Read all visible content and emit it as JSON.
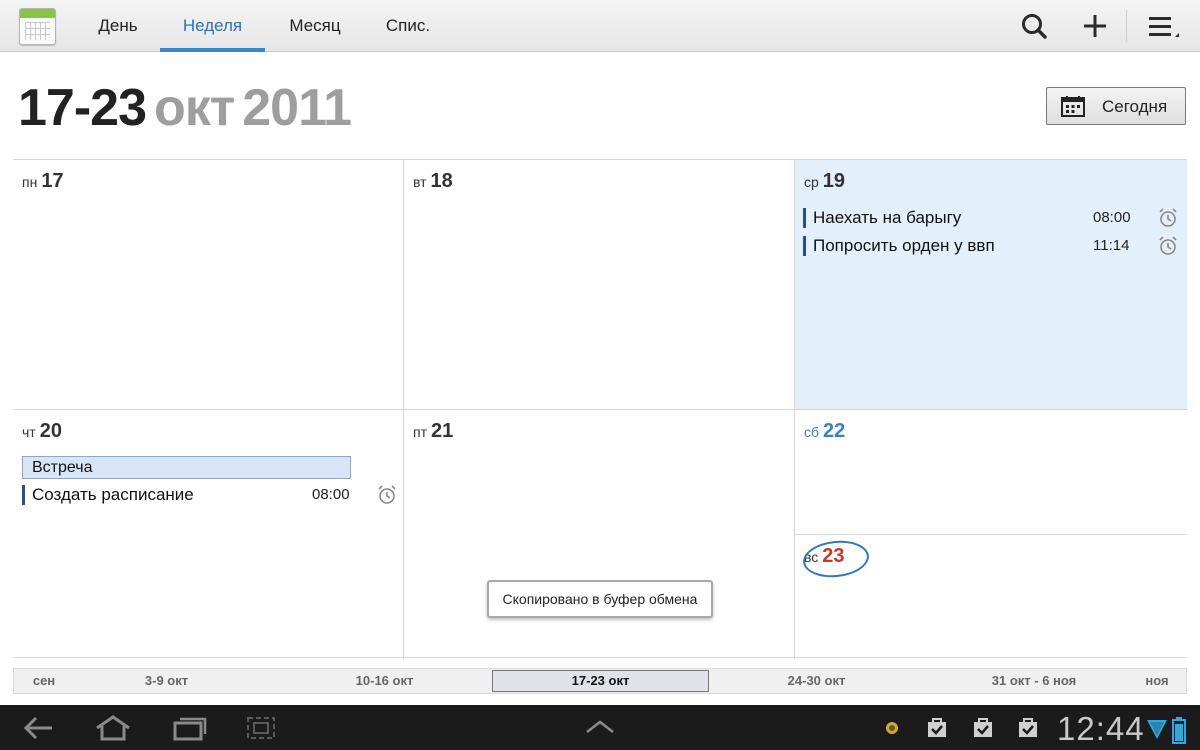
{
  "actionbar": {
    "tabs": [
      {
        "label": "День",
        "active": false
      },
      {
        "label": "Неделя",
        "active": true
      },
      {
        "label": "Месяц",
        "active": false
      },
      {
        "label": "Спис.",
        "active": false
      }
    ],
    "accent": "#3a86c8"
  },
  "header": {
    "range": "17-23",
    "month": "окт",
    "year": "2011",
    "today_button": "Сегодня"
  },
  "days": [
    {
      "weekday": "пн",
      "num": "17"
    },
    {
      "weekday": "вт",
      "num": "18"
    },
    {
      "weekday": "ср",
      "num": "19"
    },
    {
      "weekday": "чт",
      "num": "20"
    },
    {
      "weekday": "пт",
      "num": "21"
    },
    {
      "weekday": "сб",
      "num": "22"
    },
    {
      "weekday": "вс",
      "num": "23"
    }
  ],
  "events": {
    "wed": [
      {
        "title": "Наехать на барыгу",
        "time": "08:00"
      },
      {
        "title": "Попросить орден у ввп",
        "time": "11:14"
      }
    ],
    "thu_allday": "Встреча",
    "thu": [
      {
        "title": "Создать расписание",
        "time": "08:00"
      }
    ]
  },
  "toast": "Скопировано в буфер обмена",
  "week_strip": [
    "сен",
    "3-9 окт",
    "10-16 окт",
    "17-23 окт",
    "24-30 окт",
    "31 окт - 6 ноя",
    "ноя"
  ],
  "status": {
    "clock": "12:44"
  }
}
